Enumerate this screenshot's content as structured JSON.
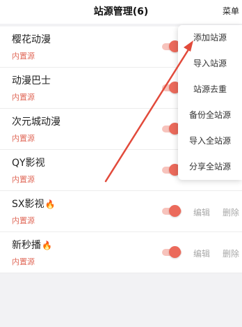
{
  "header": {
    "title": "站源管理(6)",
    "menu_label": "菜单"
  },
  "sources": [
    {
      "name": "樱花动漫",
      "tag": "内置源",
      "enabled": true,
      "hot": false
    },
    {
      "name": "动漫巴士",
      "tag": "内置源",
      "enabled": true,
      "hot": false
    },
    {
      "name": "次元城动漫",
      "tag": "内置源",
      "enabled": true,
      "hot": false
    },
    {
      "name": "QY影视",
      "tag": "内置源",
      "enabled": true,
      "hot": false
    },
    {
      "name": "SX影视",
      "tag": "内置源",
      "enabled": true,
      "hot": true,
      "edit_label": "编辑",
      "delete_label": "删除"
    },
    {
      "name": "新秒播",
      "tag": "内置源",
      "enabled": true,
      "hot": true,
      "edit_label": "编辑",
      "delete_label": "删除"
    }
  ],
  "dropdown_menu": {
    "items": [
      "添加站源",
      "导入站源",
      "站源去重",
      "备份全站源",
      "导入全站源",
      "分享全站源"
    ]
  },
  "annotation": {
    "arrow_color": "#e24a3b"
  },
  "colors": {
    "accent": "#eb6a5b",
    "tag": "#e06a5a",
    "action_text": "#a8a8a8"
  },
  "icons": {
    "hot": "fire-icon"
  }
}
